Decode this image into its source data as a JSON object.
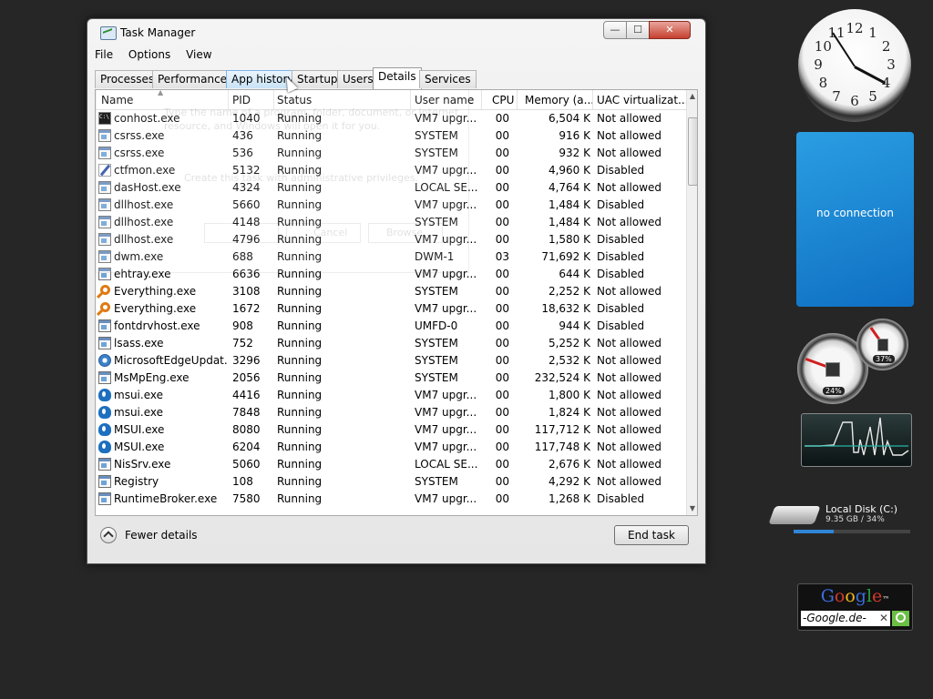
{
  "window": {
    "title": "Task Manager",
    "controls": {
      "minimize": "—",
      "maximize": "☐",
      "close": "✕"
    }
  },
  "menu": [
    "File",
    "Options",
    "View"
  ],
  "tabs": [
    {
      "label": "Processes"
    },
    {
      "label": "Performance"
    },
    {
      "label": "App history"
    },
    {
      "label": "Startup"
    },
    {
      "label": "Users"
    },
    {
      "label": "Details",
      "active": true
    },
    {
      "label": "Services"
    }
  ],
  "columns": {
    "name": "Name",
    "pid": "PID",
    "status": "Status",
    "user": "User name",
    "cpu": "CPU",
    "memory": "Memory (a...",
    "uac": "UAC virtualizat..."
  },
  "rows": [
    {
      "icon": "console-icon",
      "name": "conhost.exe",
      "pid": "1040",
      "status": "Running",
      "user": "VM7 upgr...",
      "cpu": "00",
      "memory": "6,504 K",
      "uac": "Not allowed"
    },
    {
      "icon": "window-icon",
      "name": "csrss.exe",
      "pid": "436",
      "status": "Running",
      "user": "SYSTEM",
      "cpu": "00",
      "memory": "916 K",
      "uac": "Not allowed"
    },
    {
      "icon": "window-icon",
      "name": "csrss.exe",
      "pid": "536",
      "status": "Running",
      "user": "SYSTEM",
      "cpu": "00",
      "memory": "932 K",
      "uac": "Not allowed"
    },
    {
      "icon": "pen-icon",
      "name": "ctfmon.exe",
      "pid": "5132",
      "status": "Running",
      "user": "VM7 upgr...",
      "cpu": "00",
      "memory": "4,960 K",
      "uac": "Disabled"
    },
    {
      "icon": "window-icon",
      "name": "dasHost.exe",
      "pid": "4324",
      "status": "Running",
      "user": "LOCAL SE...",
      "cpu": "00",
      "memory": "4,764 K",
      "uac": "Not allowed"
    },
    {
      "icon": "window-icon",
      "name": "dllhost.exe",
      "pid": "5660",
      "status": "Running",
      "user": "VM7 upgr...",
      "cpu": "00",
      "memory": "1,484 K",
      "uac": "Disabled"
    },
    {
      "icon": "window-icon",
      "name": "dllhost.exe",
      "pid": "4148",
      "status": "Running",
      "user": "SYSTEM",
      "cpu": "00",
      "memory": "1,484 K",
      "uac": "Not allowed"
    },
    {
      "icon": "window-icon",
      "name": "dllhost.exe",
      "pid": "4796",
      "status": "Running",
      "user": "VM7 upgr...",
      "cpu": "00",
      "memory": "1,580 K",
      "uac": "Disabled"
    },
    {
      "icon": "window-icon",
      "name": "dwm.exe",
      "pid": "688",
      "status": "Running",
      "user": "DWM-1",
      "cpu": "03",
      "memory": "71,692 K",
      "uac": "Disabled"
    },
    {
      "icon": "window-icon",
      "name": "ehtray.exe",
      "pid": "6636",
      "status": "Running",
      "user": "VM7 upgr...",
      "cpu": "00",
      "memory": "644 K",
      "uac": "Disabled"
    },
    {
      "icon": "magnifier-icon",
      "name": "Everything.exe",
      "pid": "3108",
      "status": "Running",
      "user": "SYSTEM",
      "cpu": "00",
      "memory": "2,252 K",
      "uac": "Not allowed"
    },
    {
      "icon": "magnifier-icon",
      "name": "Everything.exe",
      "pid": "1672",
      "status": "Running",
      "user": "VM7 upgr...",
      "cpu": "00",
      "memory": "18,632 K",
      "uac": "Disabled"
    },
    {
      "icon": "window-icon",
      "name": "fontdrvhost.exe",
      "pid": "908",
      "status": "Running",
      "user": "UMFD-0",
      "cpu": "00",
      "memory": "944 K",
      "uac": "Disabled"
    },
    {
      "icon": "window-icon",
      "name": "lsass.exe",
      "pid": "752",
      "status": "Running",
      "user": "SYSTEM",
      "cpu": "00",
      "memory": "5,252 K",
      "uac": "Not allowed"
    },
    {
      "icon": "update-icon",
      "name": "MicrosoftEdgeUpdat...",
      "pid": "3296",
      "status": "Running",
      "user": "SYSTEM",
      "cpu": "00",
      "memory": "2,532 K",
      "uac": "Not allowed"
    },
    {
      "icon": "window-icon",
      "name": "MsMpEng.exe",
      "pid": "2056",
      "status": "Running",
      "user": "SYSTEM",
      "cpu": "00",
      "memory": "232,524 K",
      "uac": "Not allowed"
    },
    {
      "icon": "info-icon",
      "name": "msui.exe",
      "pid": "4416",
      "status": "Running",
      "user": "VM7 upgr...",
      "cpu": "00",
      "memory": "1,800 K",
      "uac": "Not allowed"
    },
    {
      "icon": "info-icon",
      "name": "msui.exe",
      "pid": "7848",
      "status": "Running",
      "user": "VM7 upgr...",
      "cpu": "00",
      "memory": "1,824 K",
      "uac": "Not allowed"
    },
    {
      "icon": "info-icon",
      "name": "MSUI.exe",
      "pid": "8080",
      "status": "Running",
      "user": "VM7 upgr...",
      "cpu": "00",
      "memory": "117,712 K",
      "uac": "Not allowed"
    },
    {
      "icon": "info-icon",
      "name": "MSUI.exe",
      "pid": "6204",
      "status": "Running",
      "user": "VM7 upgr...",
      "cpu": "00",
      "memory": "117,748 K",
      "uac": "Not allowed"
    },
    {
      "icon": "window-icon",
      "name": "NisSrv.exe",
      "pid": "5060",
      "status": "Running",
      "user": "LOCAL SE...",
      "cpu": "00",
      "memory": "2,676 K",
      "uac": "Not allowed"
    },
    {
      "icon": "window-icon",
      "name": "Registry",
      "pid": "108",
      "status": "Running",
      "user": "SYSTEM",
      "cpu": "00",
      "memory": "4,292 K",
      "uac": "Not allowed"
    },
    {
      "icon": "window-icon",
      "name": "RuntimeBroker.exe",
      "pid": "7580",
      "status": "Running",
      "user": "VM7 upgr...",
      "cpu": "00",
      "memory": "1,268 K",
      "uac": "Disabled"
    }
  ],
  "ghost_dialog": {
    "hint_line1": "Type the name of a program, folder, document, or Internet",
    "hint_line2": "resource, and Windows will open it for you.",
    "admin_checkbox": "Create this task with administrative privileges.",
    "cancel": "Cancel",
    "browse": "Browse..."
  },
  "footer": {
    "fewer_details": "Fewer details",
    "end_task": "End task"
  },
  "gadgets": {
    "clock_numbers": [
      "12",
      "1",
      "2",
      "3",
      "4",
      "5",
      "6",
      "7",
      "8",
      "9",
      "10",
      "11"
    ],
    "weather_text": "no connection",
    "cpu_percent": "24%",
    "memory_percent": "37%",
    "disk_name": "Local Disk (C:)",
    "disk_info": "9.35 GB / 34%",
    "disk_used_fraction": 0.34,
    "google_logo": "Google™",
    "google_input": "-Google.de-",
    "google_clear": "✕"
  },
  "colors": {
    "accent": "#2a9ee3",
    "google_search": "#6bbf44"
  }
}
